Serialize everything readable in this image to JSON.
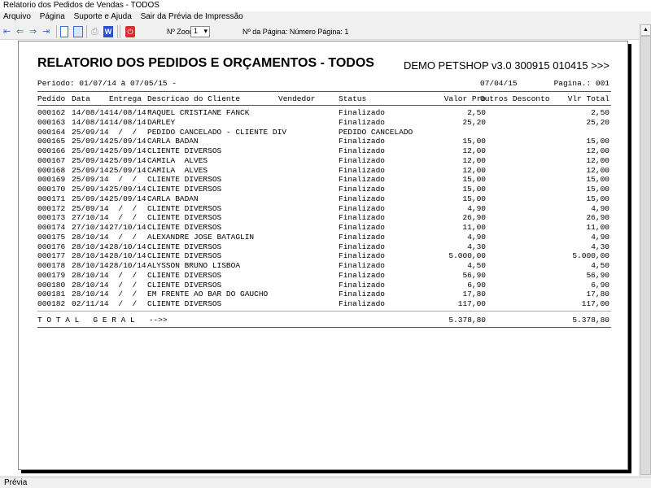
{
  "window": {
    "title": "Relatorio dos Pedidos de Vendas  - TODOS"
  },
  "menu": [
    "Arquivo",
    "Página",
    "Suporte e Ajuda",
    "Sair da Prévia de Impressão"
  ],
  "toolbar": {
    "zoom_label": "Nº Zoom",
    "zoom_value": "1",
    "page_info": "Nº da Página: Número Página: 1"
  },
  "report": {
    "title": "RELATORIO DOS PEDIDOS E ORÇAMENTOS  - TODOS",
    "company": "DEMO PETSHOP v3.0 300915 010415 >>>",
    "period": "Periodo: 01/07/14 à 07/05/15 -",
    "date": "07/04/15",
    "page": "Pagina.: 001",
    "headers": {
      "pedido": "Pedido",
      "data": "Data",
      "entrega": "Entrega",
      "cliente": "Descricao do Cliente",
      "vendedor": "Vendedor",
      "status": "Status",
      "valor": "Valor Pro",
      "outros": "Outros Desconto",
      "total": "Vlr Total"
    },
    "rows": [
      [
        "000162",
        "14/08/14",
        "14/08/14",
        "RAQUEL CRISTIANE FANCK",
        "Finalizado",
        "2,50",
        "2,50"
      ],
      [
        "000163",
        "14/08/14",
        "14/08/14",
        "DARLEY",
        "Finalizado",
        "25,20",
        "25,20"
      ],
      [
        "000164",
        "25/09/14",
        "  /  /",
        "PEDIDO CANCELADO - CLIENTE DIV",
        "PEDIDO CANCELADO",
        "",
        ""
      ],
      [
        "000165",
        "25/09/14",
        "25/09/14",
        "CARLA BADAN",
        "Finalizado",
        "15,00",
        "15,00"
      ],
      [
        "000166",
        "25/09/14",
        "25/09/14",
        "CLIENTE DIVERSOS",
        "Finalizado",
        "12,00",
        "12,00"
      ],
      [
        "000167",
        "25/09/14",
        "25/09/14",
        "CAMILA  ALVES",
        "Finalizado",
        "12,00",
        "12,00"
      ],
      [
        "000168",
        "25/09/14",
        "25/09/14",
        "CAMILA  ALVES",
        "Finalizado",
        "12,00",
        "12,00"
      ],
      [
        "000169",
        "25/09/14",
        "  /  /",
        "CLIENTE DIVERSOS",
        "Finalizado",
        "15,00",
        "15,00"
      ],
      [
        "000170",
        "25/09/14",
        "25/09/14",
        "CLIENTE DIVERSOS",
        "Finalizado",
        "15,00",
        "15,00"
      ],
      [
        "000171",
        "25/09/14",
        "25/09/14",
        "CARLA BADAN",
        "Finalizado",
        "15,00",
        "15,00"
      ],
      [
        "000172",
        "25/09/14",
        "  /  /",
        "CLIENTE DIVERSOS",
        "Finalizado",
        "4,90",
        "4,90"
      ],
      [
        "000173",
        "27/10/14",
        "  /  /",
        "CLIENTE DIVERSOS",
        "Finalizado",
        "26,90",
        "26,90"
      ],
      [
        "000174",
        "27/10/14",
        "27/10/14",
        "CLIENTE DIVERSOS",
        "Finalizado",
        "11,00",
        "11,00"
      ],
      [
        "000175",
        "28/10/14",
        "  /  /",
        "ALEXANDRE JOSE BATAGLIN",
        "Finalizado",
        "4,90",
        "4,90"
      ],
      [
        "000176",
        "28/10/14",
        "28/10/14",
        "CLIENTE DIVERSOS",
        "Finalizado",
        "4,30",
        "4,30"
      ],
      [
        "000177",
        "28/10/14",
        "28/10/14",
        "CLIENTE DIVERSOS",
        "Finalizado",
        "5.000,00",
        "5.000,00"
      ],
      [
        "000178",
        "28/10/14",
        "28/10/14",
        "ALYSSON BRUNO LISBOA",
        "Finalizado",
        "4,50",
        "4,50"
      ],
      [
        "000179",
        "28/10/14",
        "  /  /",
        "CLIENTE DIVERSOS",
        "Finalizado",
        "56,90",
        "56,90"
      ],
      [
        "000180",
        "28/10/14",
        "  /  /",
        "CLIENTE DIVERSOS",
        "Finalizado",
        "6,90",
        "6,90"
      ],
      [
        "000181",
        "28/10/14",
        "  /  /",
        "EM FRENTE AO BAR DO GAUCHO",
        "Finalizado",
        "17,80",
        "17,80"
      ],
      [
        "000182",
        "02/11/14",
        "  /  /",
        "CLIENTE DIVERSOS",
        "Finalizado",
        "117,00",
        "117,00"
      ]
    ],
    "total_label": "T O T A L   G E R A L   -->>",
    "total_valor": "5.378,80",
    "total_geral": "5.378,80"
  },
  "statusbar": {
    "text": "Prévia"
  }
}
